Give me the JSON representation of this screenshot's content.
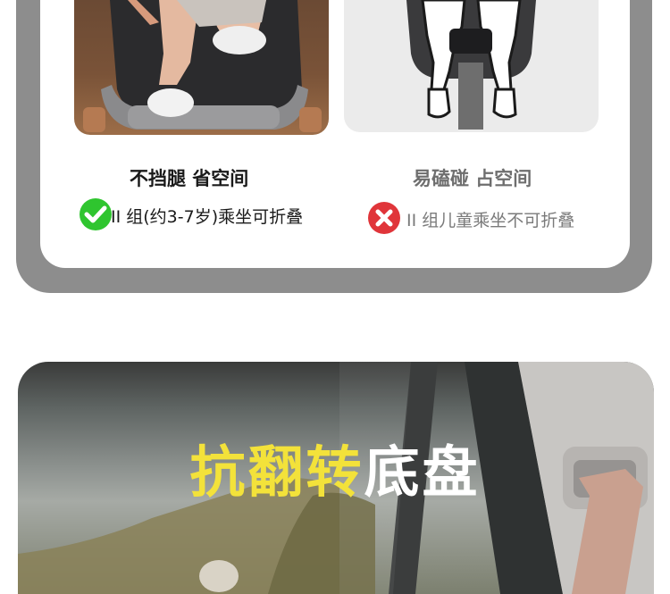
{
  "comparison": {
    "left": {
      "title": "不挡腿 省空间",
      "subtitle": "II 组(约3-7岁)乘坐可折叠",
      "status_icon": "check-circle-icon",
      "status_color": "#2fc52f"
    },
    "right": {
      "title": "易磕碰 占空间",
      "subtitle": "II 组儿童乘坐不可折叠",
      "status_icon": "cross-circle-icon",
      "status_color": "#e0353a"
    }
  },
  "feature": {
    "headline_highlight": "抗翻转",
    "headline_rest": "底盘",
    "highlight_color": "#f3e23a"
  }
}
